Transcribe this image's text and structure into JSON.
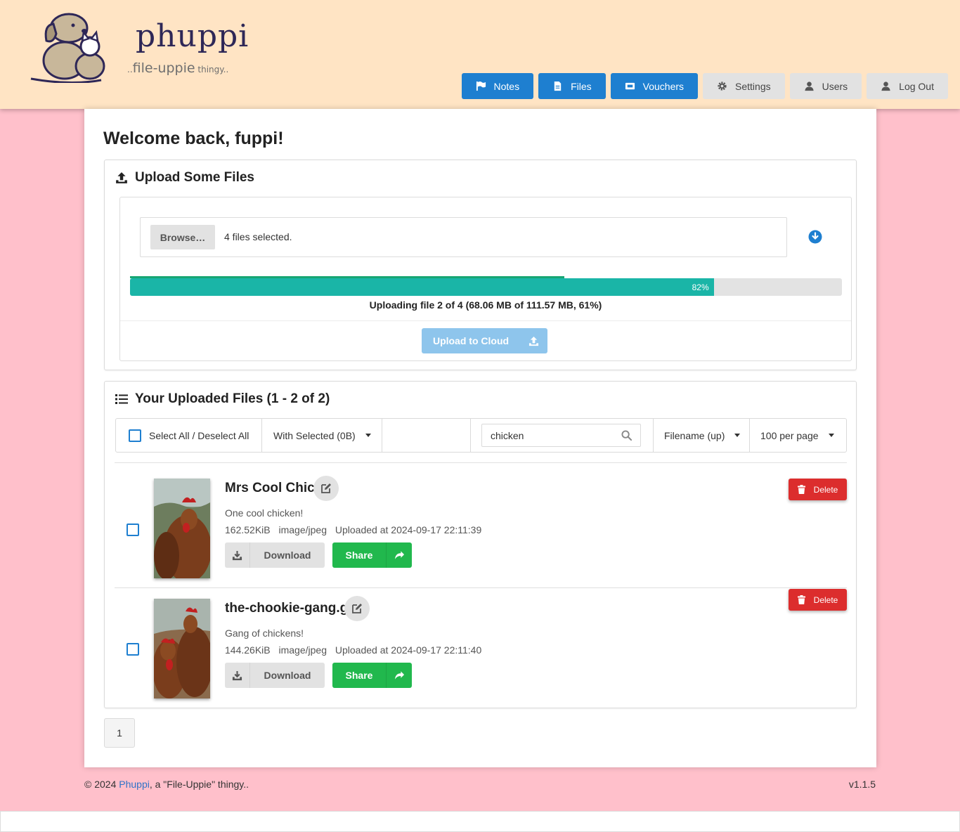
{
  "brand": {
    "name": "phuppi",
    "tagline_prefix": "..",
    "tagline_main": "file-uppie",
    "tagline_suffix": " thingy.."
  },
  "nav": [
    {
      "label": "Notes",
      "icon": "flag-icon",
      "style": "blue"
    },
    {
      "label": "Files",
      "icon": "file-icon",
      "style": "blue"
    },
    {
      "label": "Vouchers",
      "icon": "ticket-icon",
      "style": "blue"
    },
    {
      "label": "Settings",
      "icon": "gear-icon",
      "style": "grey"
    },
    {
      "label": "Users",
      "icon": "user-icon",
      "style": "grey"
    },
    {
      "label": "Log Out",
      "icon": "user-icon",
      "style": "grey"
    }
  ],
  "welcome": "Welcome back, fuppi!",
  "upload": {
    "title": "Upload Some Files",
    "browse_label": "Browse…",
    "selected_text": "4 files selected.",
    "overall_progress": 0.61,
    "file_progress_pct": 82,
    "file_progress_label": "82%",
    "status": "Uploading file 2 of 4 (68.06 MB of 111.57 MB, 61%)",
    "button_label": "Upload to Cloud"
  },
  "files_panel": {
    "title": "Your Uploaded Files (1 - 2 of 2)",
    "select_all_label": "Select All / Deselect All",
    "with_selected_label": "With Selected (0B)",
    "search_value": "chicken",
    "sort_label": "Filename (up)",
    "per_page_label": "100 per page"
  },
  "files": [
    {
      "name": "Mrs Cool Chick",
      "description": "One cool chicken!",
      "size": "162.52KiB",
      "type": "image/jpeg",
      "uploaded": "Uploaded at 2024-09-17 22:11:39",
      "download_label": "Download",
      "share_label": "Share",
      "delete_label": "Delete"
    },
    {
      "name": "the-chookie-gang.gif",
      "description": "Gang of chickens!",
      "size": "144.26KiB",
      "type": "image/jpeg",
      "uploaded": "Uploaded at 2024-09-17 22:11:40",
      "download_label": "Download",
      "share_label": "Share",
      "delete_label": "Delete"
    }
  ],
  "pagination": {
    "current_page": "1"
  },
  "footer": {
    "prefix": "© 2024 ",
    "link_text": "Phuppi",
    "suffix": ", a \"File-Uppie\" thingy..",
    "version": "v1.1.5"
  },
  "colors": {
    "page_bg": "#ffc0cb",
    "header_bg": "#ffe4c4",
    "primary": "#1e7fd0",
    "progress": "#1ab5a7",
    "share": "#21b84d",
    "delete": "#dc2d2d"
  }
}
